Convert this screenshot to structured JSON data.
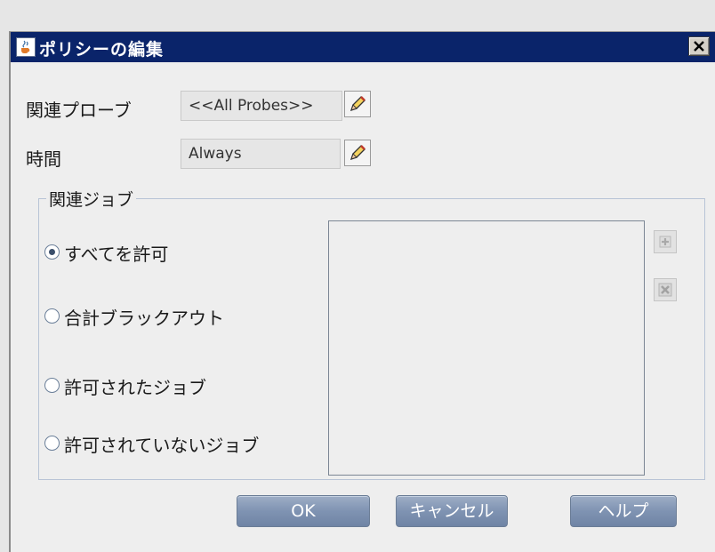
{
  "dialog": {
    "title": "ポリシーの編集",
    "close_glyph": "✕"
  },
  "fields": {
    "probe_label": "関連プローブ",
    "probe_value": "<<All Probes>>",
    "time_label": "時間",
    "time_value": "Always"
  },
  "jobs_group": {
    "legend": "関連ジョブ",
    "options": [
      {
        "label": "すべてを許可",
        "selected": true
      },
      {
        "label": "合計ブラックアウト",
        "selected": false
      },
      {
        "label": "許可されたジョブ",
        "selected": false
      },
      {
        "label": "許可されていないジョブ",
        "selected": false
      }
    ],
    "items": []
  },
  "buttons": {
    "ok": "OK",
    "cancel": "キャンセル",
    "help": "ヘルプ"
  },
  "colors": {
    "titlebar": "#0a246a",
    "button": "#7f93b2"
  },
  "icons": {
    "title": "java-cup-icon",
    "edit": "pencil-icon",
    "add": "plus-icon",
    "remove": "x-icon"
  }
}
